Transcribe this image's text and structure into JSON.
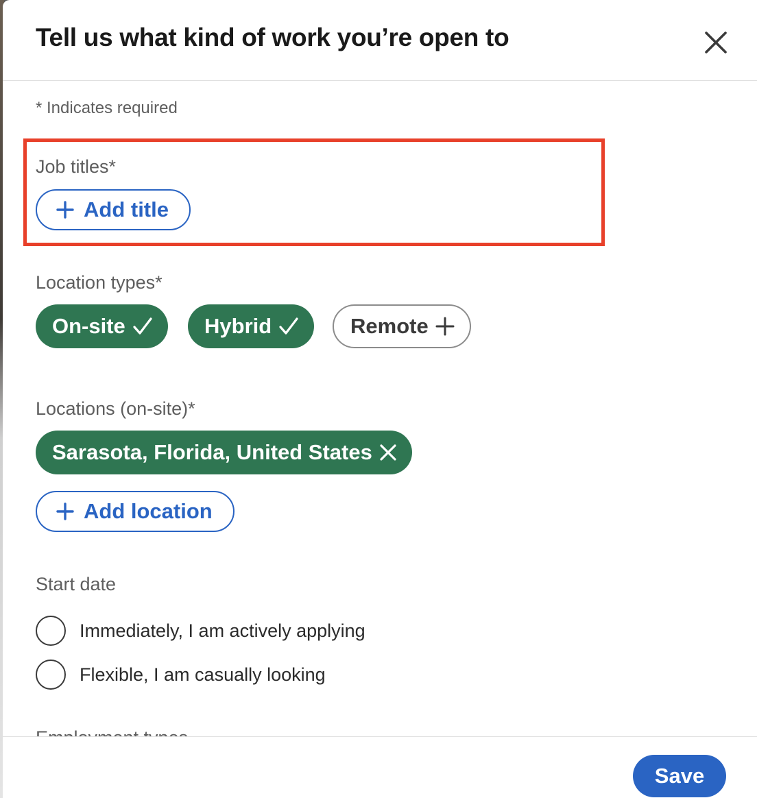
{
  "dialog": {
    "title": "Tell us what kind of work you’re open to",
    "close_icon": "close-icon"
  },
  "form": {
    "required_note": "* Indicates required",
    "job_titles": {
      "label": "Job titles*",
      "add_button": "Add title",
      "highlight_color": "#e8402a"
    },
    "location_types": {
      "label": "Location types*",
      "options": [
        {
          "label": "On-site",
          "selected": true,
          "icon": "checkmark-icon"
        },
        {
          "label": "Hybrid",
          "selected": true,
          "icon": "checkmark-icon"
        },
        {
          "label": "Remote",
          "selected": false,
          "icon": "plus-icon"
        }
      ]
    },
    "locations_onsite": {
      "label": "Locations (on-site)*",
      "selected": [
        {
          "label": "Sarasota, Florida, United States",
          "icon": "remove-icon"
        }
      ],
      "add_button": "Add location"
    },
    "start_date": {
      "label": "Start date",
      "options": [
        {
          "label": "Immediately, I am actively applying",
          "selected": false
        },
        {
          "label": "Flexible, I am casually looking",
          "selected": false
        }
      ]
    },
    "employment_types": {
      "label": "Employment types"
    }
  },
  "footer": {
    "save_label": "Save"
  },
  "colors": {
    "accent_blue": "#2a64c3",
    "selected_green": "#2f7652"
  }
}
